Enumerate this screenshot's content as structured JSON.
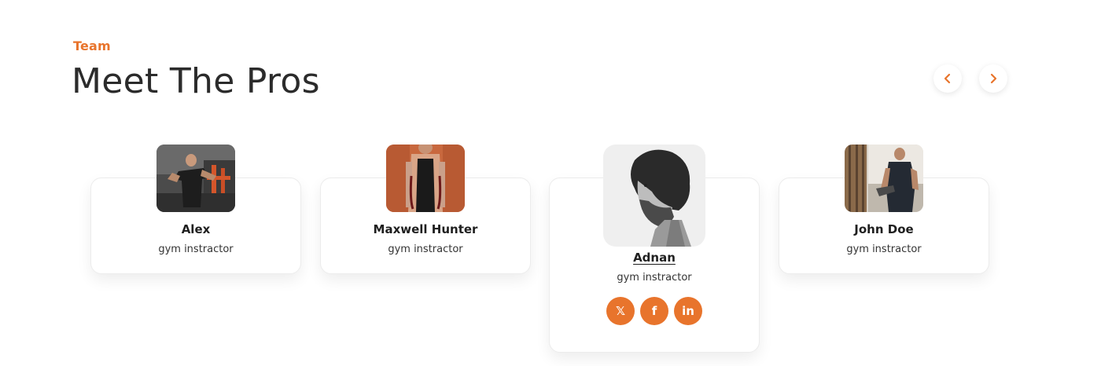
{
  "section": {
    "eyebrow": "Team",
    "title": "Meet The Pros"
  },
  "nav": {
    "prev_icon": "chevron-left-icon",
    "next_icon": "chevron-right-icon"
  },
  "colors": {
    "accent": "#e8742c",
    "text": "#2b2b2b"
  },
  "members": [
    {
      "name": "Alex",
      "role": "gym instractor"
    },
    {
      "name": "Maxwell Hunter",
      "role": "gym instractor"
    },
    {
      "name": "Adnan",
      "role": "gym instractor",
      "active": true,
      "socials": [
        {
          "icon": "x-twitter-icon",
          "glyph": "𝕏"
        },
        {
          "icon": "facebook-icon",
          "glyph": "f"
        },
        {
          "icon": "linkedin-icon",
          "glyph": "in"
        }
      ]
    },
    {
      "name": "John Doe",
      "role": "gym instractor"
    }
  ]
}
